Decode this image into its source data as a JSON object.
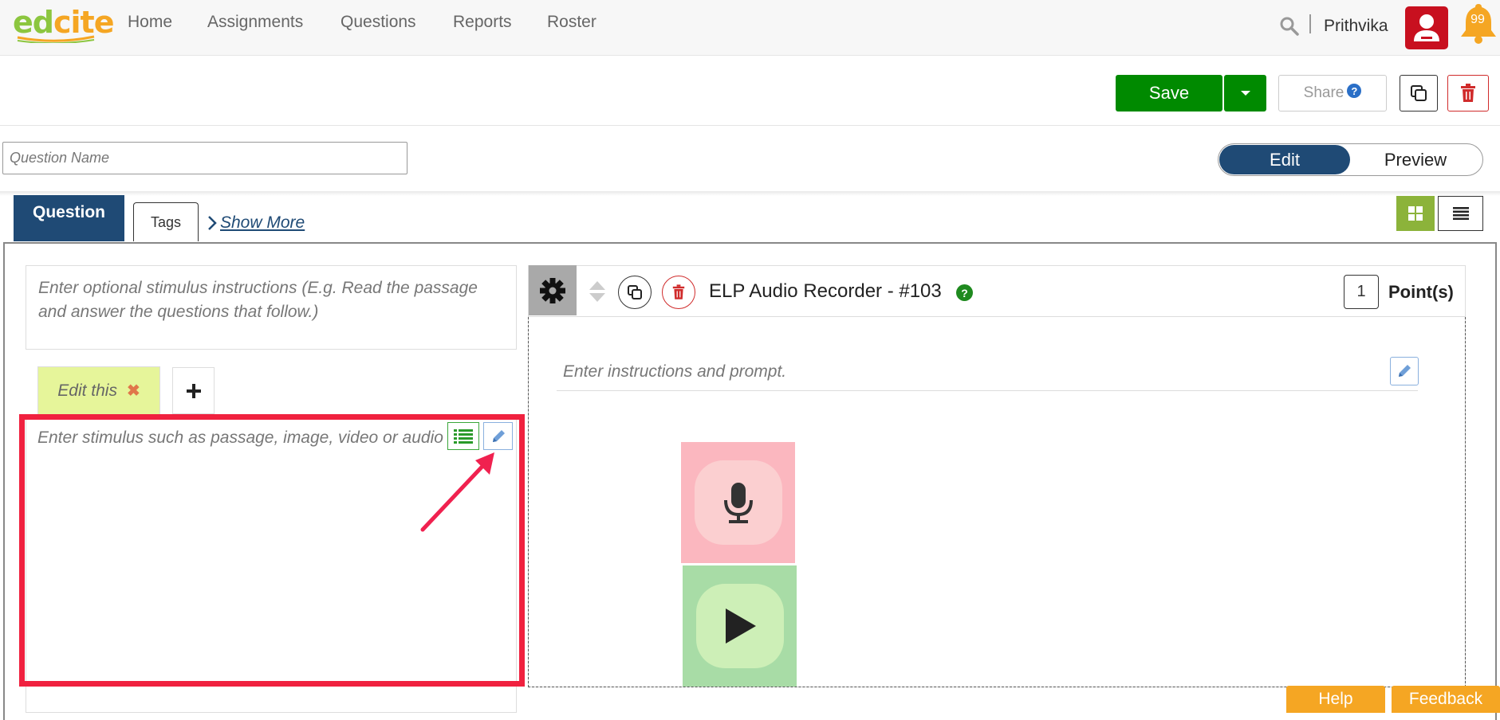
{
  "brand": {
    "logo_part1": "ed",
    "logo_part2": "cite"
  },
  "nav": {
    "items": [
      {
        "label": "Home"
      },
      {
        "label": "Assignments"
      },
      {
        "label": "Questions"
      },
      {
        "label": "Reports"
      },
      {
        "label": "Roster"
      }
    ],
    "user_name": "Prithvika",
    "notification_count": "99",
    "icons": [
      "search-icon",
      "user-avatar-icon",
      "bell-icon"
    ]
  },
  "toolbar": {
    "save_label": "Save",
    "share_label": "Share",
    "share_help": "?",
    "icons": [
      "chevron-down-icon",
      "copy-icon",
      "trash-icon"
    ]
  },
  "question_name": {
    "placeholder": "Question Name",
    "value": ""
  },
  "mode_toggle": {
    "edit_label": "Edit",
    "preview_label": "Preview",
    "selected": "Edit"
  },
  "tabs": {
    "question_label": "Question",
    "tags_label": "Tags",
    "show_more_label": "Show More"
  },
  "stimulus": {
    "instructions_placeholder": "Enter optional stimulus instructions (E.g. Read the passage and answer the questions that follow.)",
    "edit_tab_label": "Edit this",
    "edit_tab_close": "✖",
    "content_placeholder": "Enter stimulus such as passage, image, video or audio clip"
  },
  "question": {
    "title": "ELP Audio Recorder - #103",
    "help": "?",
    "points_value": "1",
    "points_label": "Point(s)",
    "prompt_placeholder": "Enter instructions and prompt."
  },
  "footer": {
    "help_label": "Help",
    "feedback_label": "Feedback"
  },
  "colors": {
    "brand_green": "#8cc63f",
    "brand_orange": "#f5a623",
    "save_green": "#008a00",
    "navy": "#1f4a75",
    "danger_red": "#d02b2b",
    "highlight_red": "#f0213f",
    "record_pink": "#fbb7bf",
    "play_green": "#a8dca6"
  }
}
